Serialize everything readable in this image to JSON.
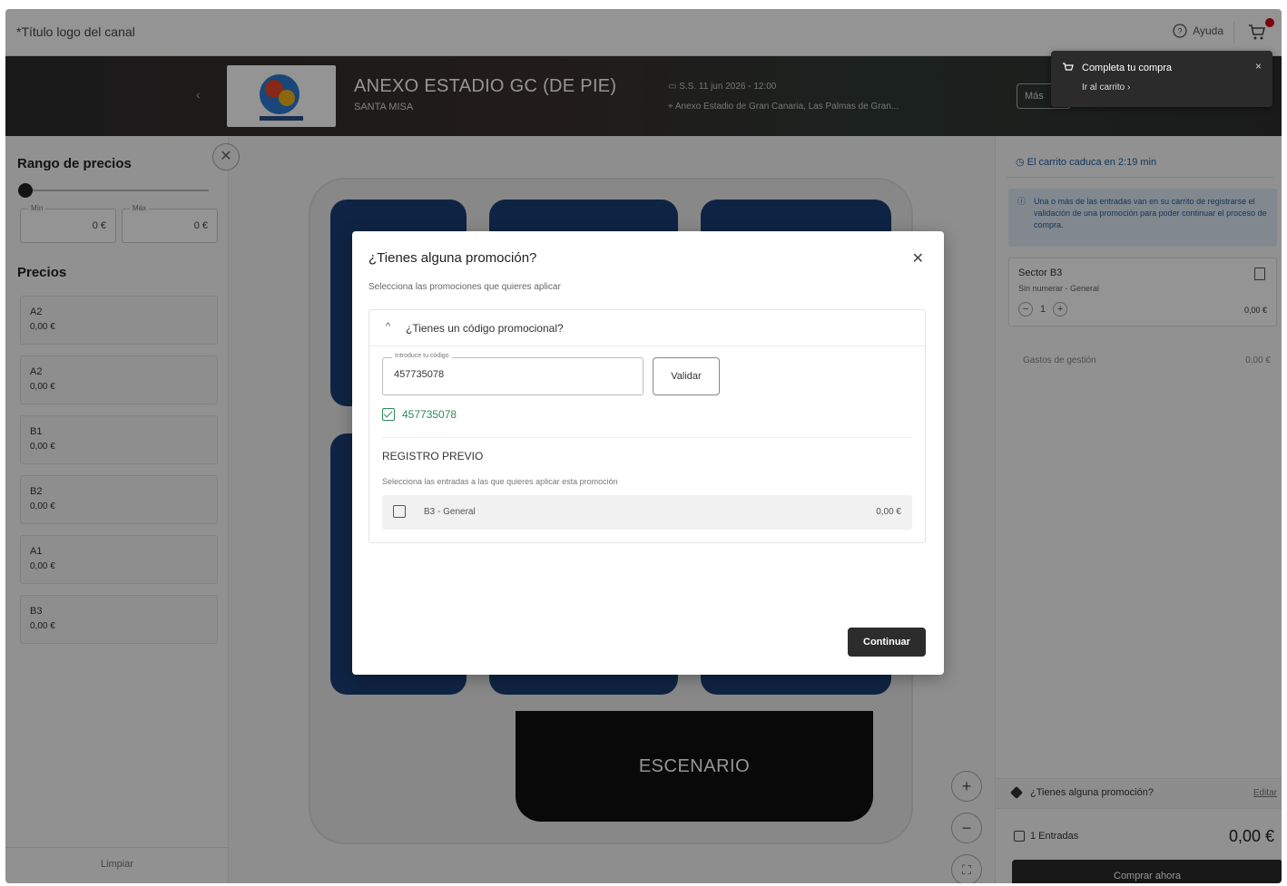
{
  "header": {
    "site_title": "*Título logo del canal",
    "help_label": "Ayuda",
    "cart_icon": "cart-icon",
    "help_icon": "help-circle-icon"
  },
  "banner": {
    "event_title": "ANEXO ESTADIO GC (DE PIE)",
    "event_subtitle": "SANTA MISA",
    "date_text": "S.S. 11 jun 2026 - 12:00",
    "place_text": "Anexo Estadio de Gran Canaria, Las Palmas de Gran...",
    "more_label": "Más"
  },
  "toast": {
    "title": "Completa tu compra",
    "link": "Ir al carrito ›"
  },
  "filters": {
    "price_range_title": "Rango de precios",
    "min_label": "Mín",
    "max_label": "Máx",
    "min_value": "0 €",
    "max_value": "0 €",
    "slider_fraction": 0,
    "prices_title": "Precios",
    "prices": [
      {
        "name": "A2",
        "price": "0,00 €"
      },
      {
        "name": "A2",
        "price": "0,00 €"
      },
      {
        "name": "B1",
        "price": "0,00 €"
      },
      {
        "name": "B2",
        "price": "0,00 €"
      },
      {
        "name": "A1",
        "price": "0,00 €"
      },
      {
        "name": "B3",
        "price": "0,00 €"
      }
    ],
    "clear_label": "Limpiar"
  },
  "map": {
    "stage_label": "ESCENARIO",
    "zoom_in": "+",
    "zoom_out": "−",
    "fit": "⛶",
    "block_color": "#1a3e75"
  },
  "cart": {
    "timer_text": "El carrito caduca en 2:19 min",
    "info_text": "Una o más de las entradas van en su carrito de registrarse el validación de una promoción para poder continuar el proceso de compra.",
    "sector_title": "Sector B3",
    "sector_detail": "Sin numerar - General",
    "quantity": "1",
    "sector_price": "0,00 €",
    "fees_label": "Gastos de gestión",
    "fees_value": "0,00 €",
    "promo_label": "¿Tienes alguna promoción?",
    "promo_edit": "Editar",
    "tickets_summary": "1 Entradas",
    "total": "0,00 €",
    "buy_label": "Comprar ahora"
  },
  "modal": {
    "title": "¿Tienes alguna promoción?",
    "subtitle": "Selecciona las promociones que quieres aplicar",
    "accordion_title": "¿Tienes un código promocional?",
    "code_field_label": "Introduce tu código",
    "code_value": "457735078",
    "validate_label": "Validar",
    "validated_code": "457735078",
    "promotion_name": "REGISTRO PREVIO",
    "promotion_hint": "Selecciona las entradas a las que quieres aplicar esta promoción",
    "ticket_name": "B3 - General",
    "ticket_price": "0,00 €",
    "continue_label": "Continuar"
  }
}
